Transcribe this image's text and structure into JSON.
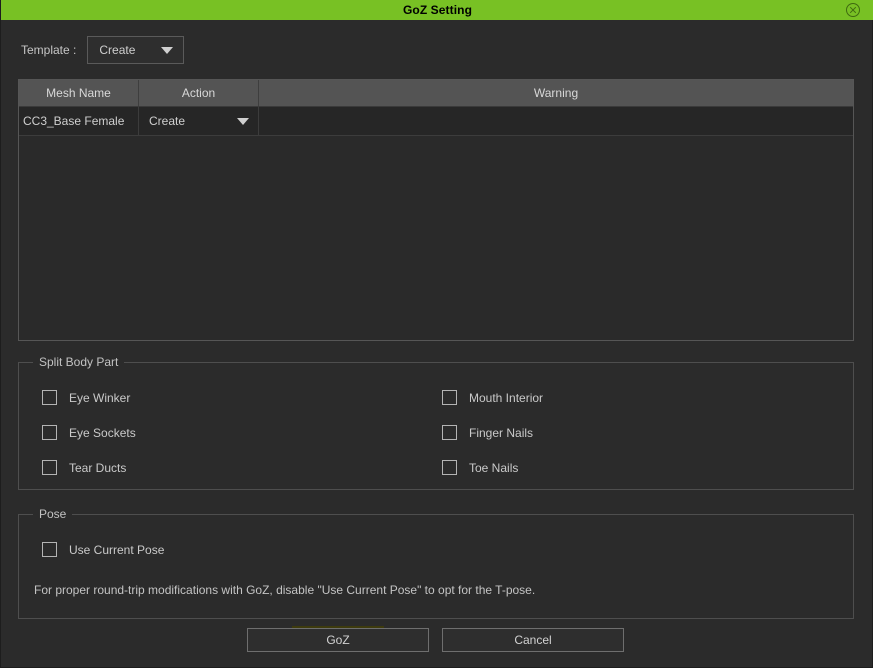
{
  "window": {
    "title": "GoZ Setting",
    "close_icon": "close-circle-icon",
    "titlebar_color": "#78c124"
  },
  "template": {
    "label": "Template :",
    "value": "Create",
    "dropdown_icon": "chevron-down-icon"
  },
  "mesh_table": {
    "columns": [
      "Mesh Name",
      "Action",
      "Warning"
    ],
    "rows": [
      {
        "mesh_name": "CC3_Base Female",
        "action": "Create",
        "warning": ""
      }
    ]
  },
  "split_body_part": {
    "title": "Split Body Part",
    "left_column": [
      {
        "label": "Eye Winker",
        "checked": false
      },
      {
        "label": "Eye Sockets",
        "checked": false
      },
      {
        "label": "Tear Ducts",
        "checked": false
      }
    ],
    "right_column": [
      {
        "label": "Mouth Interior",
        "checked": false
      },
      {
        "label": "Finger Nails",
        "checked": false
      },
      {
        "label": "Toe Nails",
        "checked": false
      }
    ]
  },
  "pose": {
    "title": "Pose",
    "use_current_pose": {
      "label": "Use Current Pose",
      "checked": false
    },
    "note": "For proper round-trip modifications with GoZ, disable \"Use Current Pose\" to opt for the T-pose."
  },
  "buttons": {
    "confirm": "GoZ",
    "cancel": "Cancel"
  }
}
